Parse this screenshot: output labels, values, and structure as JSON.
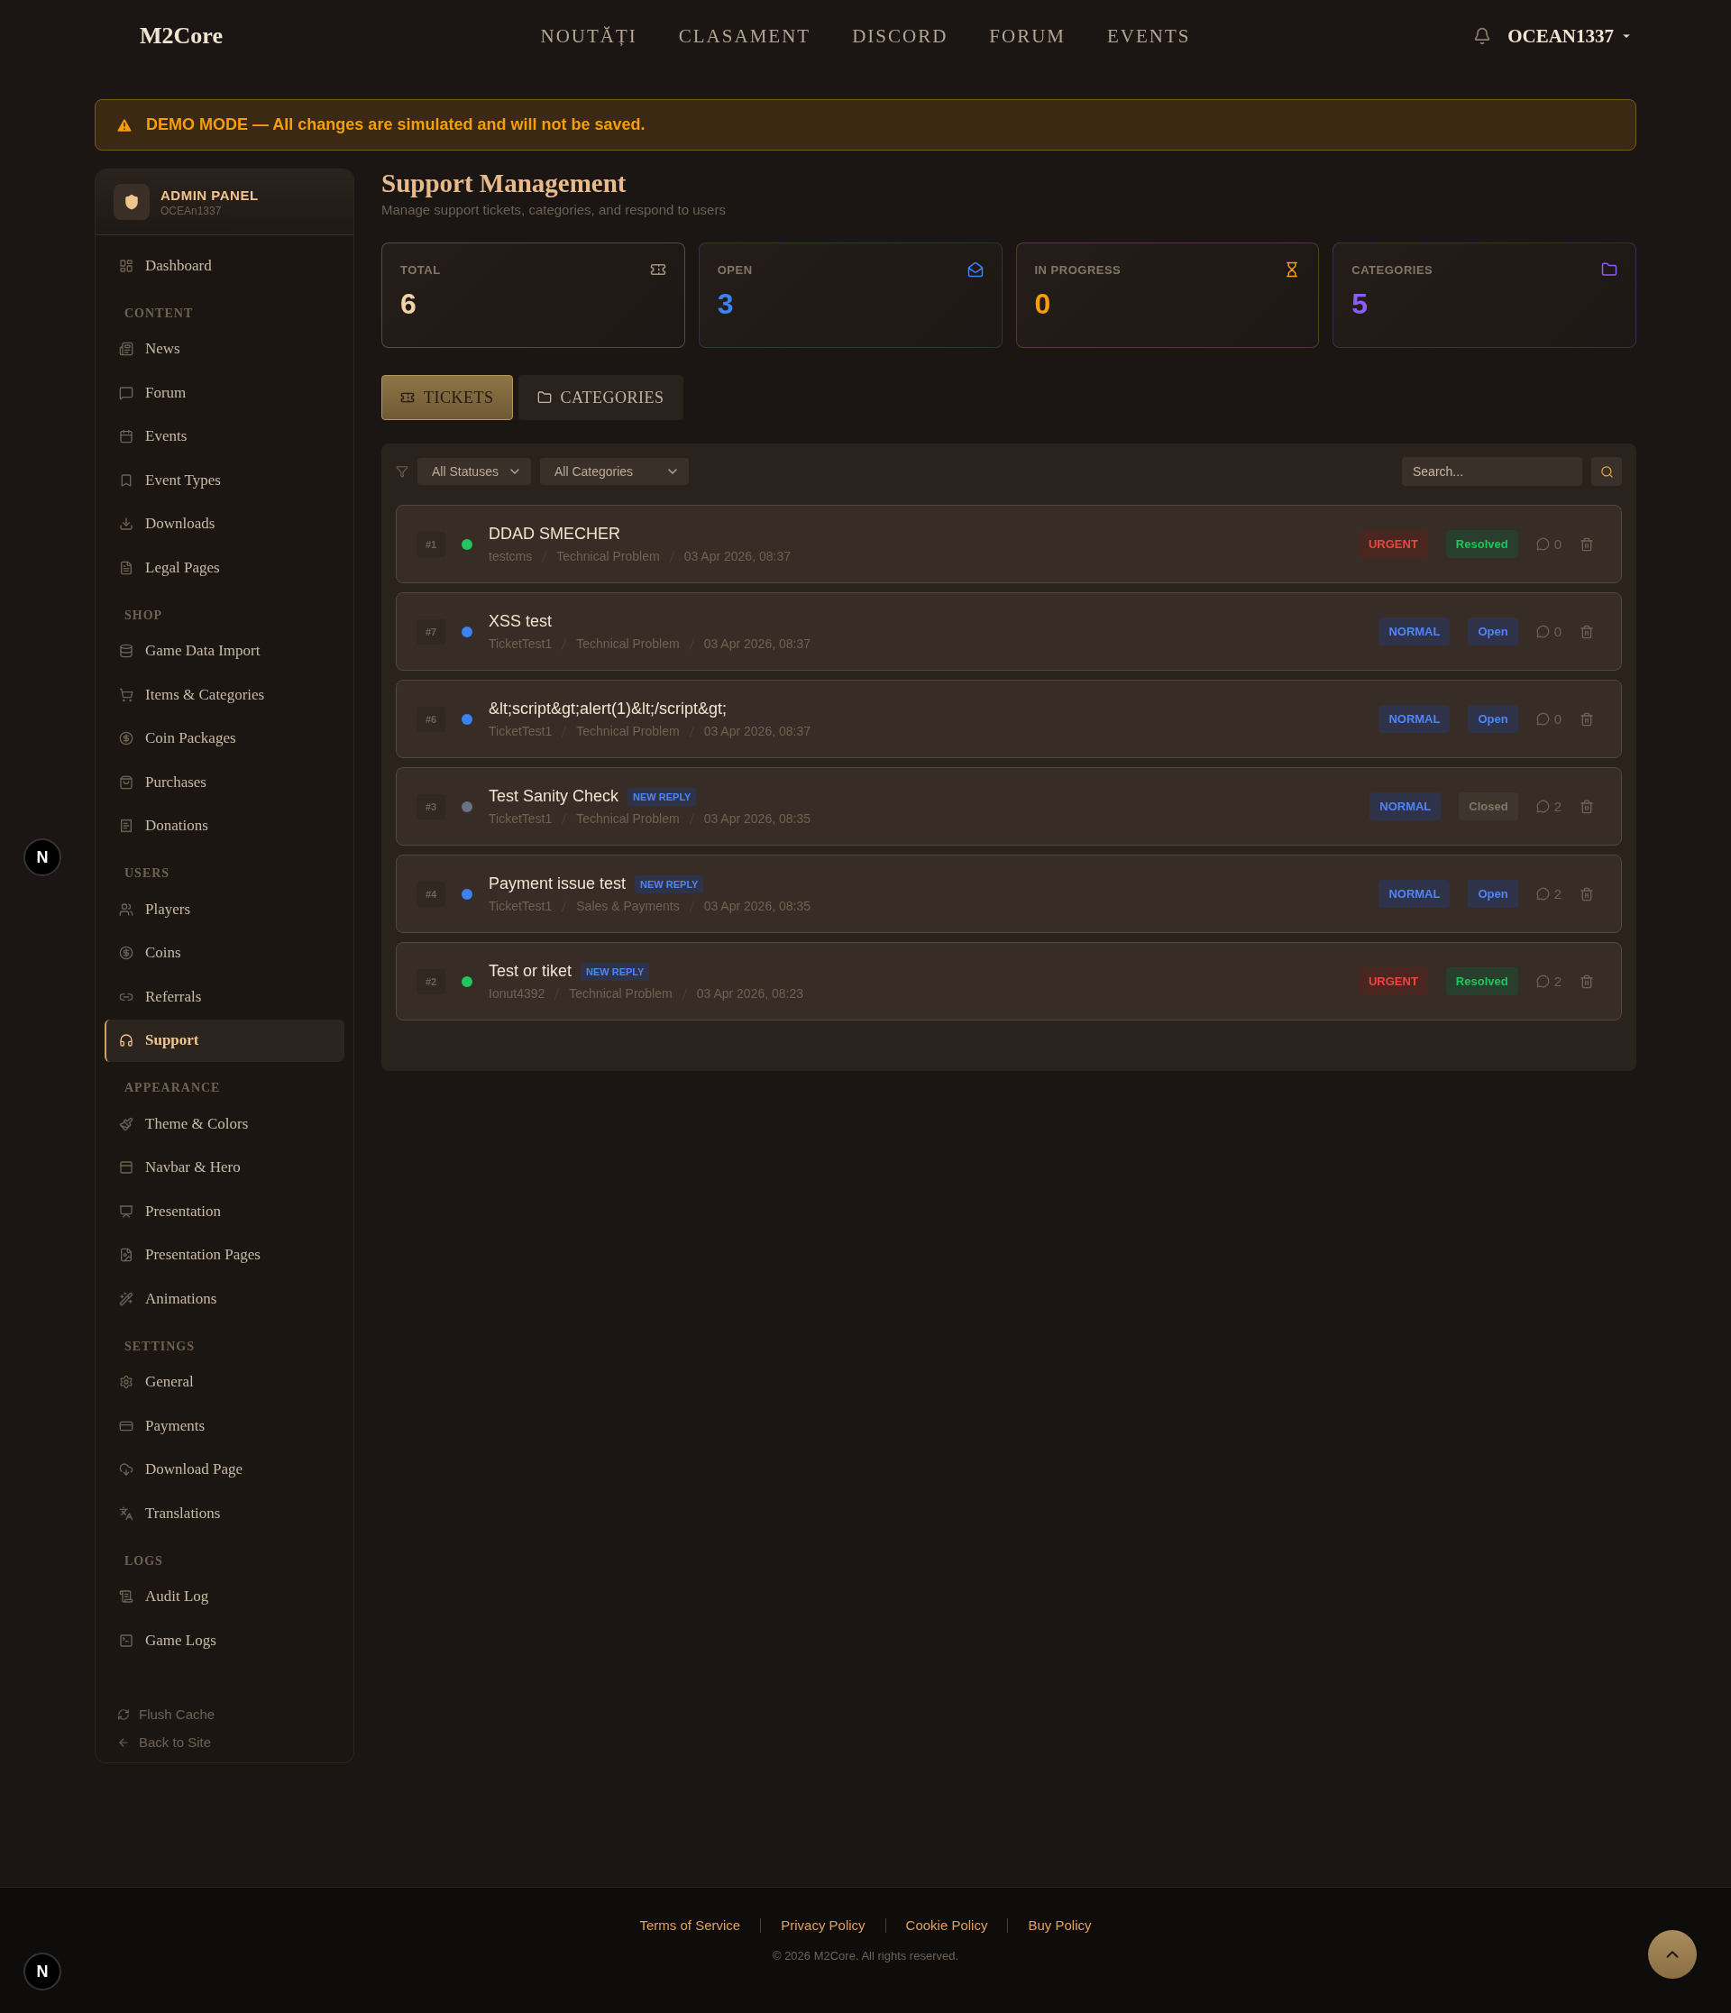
{
  "navbar": {
    "logo": "M2Core",
    "links": [
      "NOUTĂȚI",
      "CLASAMENT",
      "DISCORD",
      "FORUM",
      "EVENTS"
    ],
    "user": "OCEAN1337"
  },
  "banner": {
    "text": "DEMO MODE — All changes are simulated and will not be saved."
  },
  "sidebar": {
    "title": "ADMIN PANEL",
    "subtitle": "OCEAn1337",
    "sections": [
      {
        "items": [
          {
            "label": "Dashboard",
            "selected": false
          }
        ]
      },
      {
        "heading": "CONTENT",
        "items": [
          {
            "label": "News",
            "selected": false
          },
          {
            "label": "Forum",
            "selected": false
          },
          {
            "label": "Events",
            "selected": false
          },
          {
            "label": "Event Types",
            "selected": false
          },
          {
            "label": "Downloads",
            "selected": false
          },
          {
            "label": "Legal Pages",
            "selected": false
          }
        ]
      },
      {
        "heading": "SHOP",
        "items": [
          {
            "label": "Game Data Import",
            "selected": false
          },
          {
            "label": "Items & Categories",
            "selected": false
          },
          {
            "label": "Coin Packages",
            "selected": false
          },
          {
            "label": "Purchases",
            "selected": false
          },
          {
            "label": "Donations",
            "selected": false
          }
        ]
      },
      {
        "heading": "USERS",
        "items": [
          {
            "label": "Players",
            "selected": false
          },
          {
            "label": "Coins",
            "selected": false
          },
          {
            "label": "Referrals",
            "selected": false
          },
          {
            "label": "Support",
            "selected": true
          }
        ]
      },
      {
        "heading": "APPEARANCE",
        "items": [
          {
            "label": "Theme & Colors",
            "selected": false
          },
          {
            "label": "Navbar & Hero",
            "selected": false
          },
          {
            "label": "Presentation",
            "selected": false
          },
          {
            "label": "Presentation Pages",
            "selected": false
          },
          {
            "label": "Animations",
            "selected": false
          }
        ]
      },
      {
        "heading": "SETTINGS",
        "items": [
          {
            "label": "General",
            "selected": false
          },
          {
            "label": "Payments",
            "selected": false
          },
          {
            "label": "Download Page",
            "selected": false
          },
          {
            "label": "Translations",
            "selected": false
          }
        ]
      },
      {
        "heading": "LOGS",
        "items": [
          {
            "label": "Audit Log",
            "selected": false
          },
          {
            "label": "Game Logs",
            "selected": false
          }
        ]
      }
    ],
    "footer_links": [
      "Flush Cache",
      "Back to Site"
    ]
  },
  "page": {
    "title": "Support Management",
    "subtitle": "Manage support tickets, categories, and respond to users"
  },
  "stats": [
    {
      "label": "TOTAL",
      "value": "6",
      "color": "#f0d3a8"
    },
    {
      "label": "OPEN",
      "value": "3",
      "color": "#3b82f6"
    },
    {
      "label": "IN PROGRESS",
      "value": "0",
      "color": "#f59e0b"
    },
    {
      "label": "CATEGORIES",
      "value": "5",
      "color": "#8b5cf6"
    }
  ],
  "tabs": [
    {
      "label": "TICKETS",
      "selected": true
    },
    {
      "label": "CATEGORIES",
      "selected": false
    }
  ],
  "filters": {
    "status": "All Statuses",
    "category": "All Categories",
    "search_placeholder": "Search..."
  },
  "tickets": [
    {
      "id": "#1",
      "color": "#22c55e",
      "title": "DDAD SMECHER",
      "user": "testcms",
      "category": "Technical Problem",
      "date": "03 Apr 2026, 08:37",
      "priority": {
        "label": "URGENT",
        "kind": "urgent"
      },
      "status": {
        "label": "Resolved",
        "kind": "resolved"
      },
      "replies": "0"
    },
    {
      "id": "#7",
      "color": "#3b82f6",
      "title": "XSS test",
      "user": "TicketTest1",
      "category": "Technical Problem",
      "date": "03 Apr 2026, 08:37",
      "priority": {
        "label": "NORMAL",
        "kind": "normal"
      },
      "status": {
        "label": "Open",
        "kind": "open"
      },
      "replies": "0"
    },
    {
      "id": "#6",
      "color": "#3b82f6",
      "title": "&lt;script&gt;alert(1)&lt;/script&gt;",
      "user": "TicketTest1",
      "category": "Technical Problem",
      "date": "03 Apr 2026, 08:37",
      "priority": {
        "label": "NORMAL",
        "kind": "normal"
      },
      "status": {
        "label": "Open",
        "kind": "open"
      },
      "replies": "0"
    },
    {
      "id": "#3",
      "color": "#6b7280",
      "title": "Test Sanity Check",
      "badge": "NEW REPLY",
      "user": "TicketTest1",
      "category": "Technical Problem",
      "date": "03 Apr 2026, 08:35",
      "priority": {
        "label": "NORMAL",
        "kind": "normal"
      },
      "status": {
        "label": "Closed",
        "kind": "closed"
      },
      "replies": "2"
    },
    {
      "id": "#4",
      "color": "#3b82f6",
      "title": "Payment issue test",
      "badge": "NEW REPLY",
      "user": "TicketTest1",
      "category": "Sales & Payments",
      "date": "03 Apr 2026, 08:35",
      "priority": {
        "label": "NORMAL",
        "kind": "normal"
      },
      "status": {
        "label": "Open",
        "kind": "open"
      },
      "replies": "2"
    },
    {
      "id": "#2",
      "color": "#22c55e",
      "title": "Test or tiket",
      "badge": "NEW REPLY",
      "user": "Ionut4392",
      "category": "Technical Problem",
      "date": "03 Apr 2026, 08:23",
      "priority": {
        "label": "URGENT",
        "kind": "urgent"
      },
      "status": {
        "label": "Resolved",
        "kind": "resolved"
      },
      "replies": "2"
    }
  ],
  "footer": {
    "links": [
      "Terms of Service",
      "Privacy Policy",
      "Cookie Policy",
      "Buy Policy"
    ],
    "copyright": "© 2026 M2Core. All rights reserved."
  },
  "dev_indicators": [
    "N",
    "N"
  ]
}
